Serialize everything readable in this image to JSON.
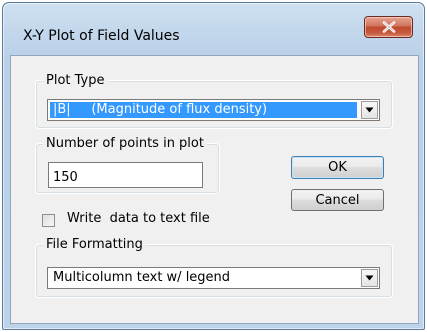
{
  "window": {
    "title": "X-Y Plot of Field Values",
    "close_icon": "close-x-icon"
  },
  "plot_type": {
    "legend": "Plot Type",
    "selected": "|B|     (Magnitude of flux density)",
    "selection_highlight": "#3399ff"
  },
  "num_points": {
    "legend": "Number of points in plot",
    "value": "150"
  },
  "buttons": {
    "ok": "OK",
    "cancel": "Cancel"
  },
  "write_data": {
    "label": "Write  data to text file",
    "checked": false
  },
  "file_formatting": {
    "legend": "File Formatting",
    "selected": "Multicolumn text w/ legend"
  },
  "colors": {
    "close_button": "#c65a3e",
    "default_button_border": "#3c7fb1"
  }
}
